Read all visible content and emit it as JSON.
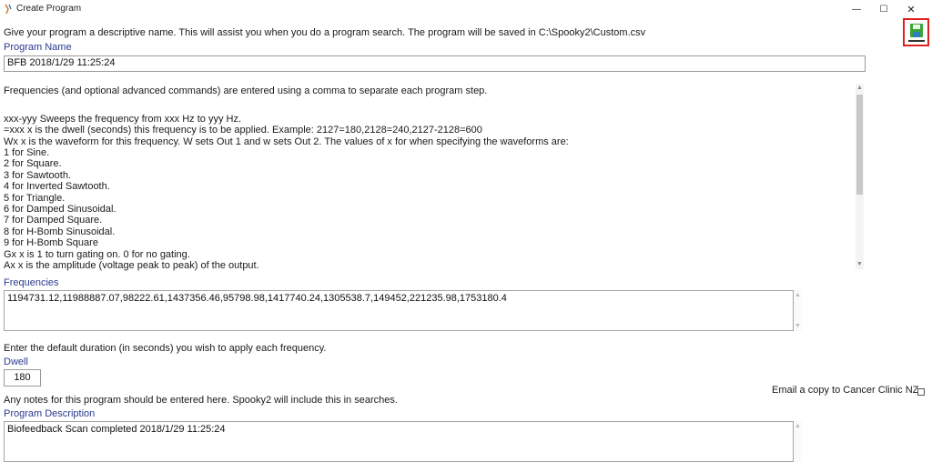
{
  "window": {
    "title": "Create Program",
    "minimize_label": "—",
    "maximize_label": "☐",
    "close_label": "✕"
  },
  "intro_text": "Give your program a descriptive name. This will assist you when you do a program search. The program will be saved in C:\\Spooky2\\Custom.csv",
  "program_name": {
    "label": "Program Name",
    "value": "BFB 2018/1/29 11:25:24"
  },
  "help": {
    "lines": [
      "Frequencies (and optional advanced commands) are entered using a comma to separate each program step.",
      "",
      "xxx-yyy Sweeps the frequency from xxx Hz to yyy Hz.",
      "=xxx     x is the dwell (seconds) this frequency is to be applied. Example: 2127=180,2128=240,2127-2128=600",
      "Wx       x is the waveform for this frequency. W sets Out 1 and w sets Out 2. The values of x for when specifying the waveforms are:",
      "1 for Sine.",
      "2 for Square.",
      "3 for Sawtooth.",
      "4 for Inverted Sawtooth.",
      "5 for Triangle.",
      "6 for Damped Sinusoidal.",
      "7 for Damped Square.",
      "8 for H-Bomb Sinusoidal.",
      "9 for H-Bomb Square",
      "Gx  x is 1 to turn gating on. 0 for no gating.",
      "Ax  x is the amplitude (voltage peak to peak) of the output."
    ]
  },
  "frequencies": {
    "label": "Frequencies",
    "value": "1194731.12,11988887.07,98222.61,1437356.46,95798.98,1417740.24,1305538.7,149452,221235.98,1753180.4"
  },
  "dwell": {
    "instruction": "Enter the default duration (in seconds) you wish to apply each frequency.",
    "label": "Dwell",
    "value": "180"
  },
  "email_copy": {
    "label": "Email a copy to Cancer Clinic NZ",
    "checked": false
  },
  "notes_instruction": "Any notes for this program should be entered here. Spooky2 will include this in searches.",
  "description": {
    "label": "Program Description",
    "value": "Biofeedback Scan completed 2018/1/29 11:25:24"
  },
  "colors": {
    "label_blue": "#2b3a8f",
    "save_border": "#e02020",
    "save_icon_green": "#3aa535"
  },
  "icons": [
    "app-icon",
    "save-icon",
    "scroll-up-icon",
    "scroll-down-icon"
  ]
}
